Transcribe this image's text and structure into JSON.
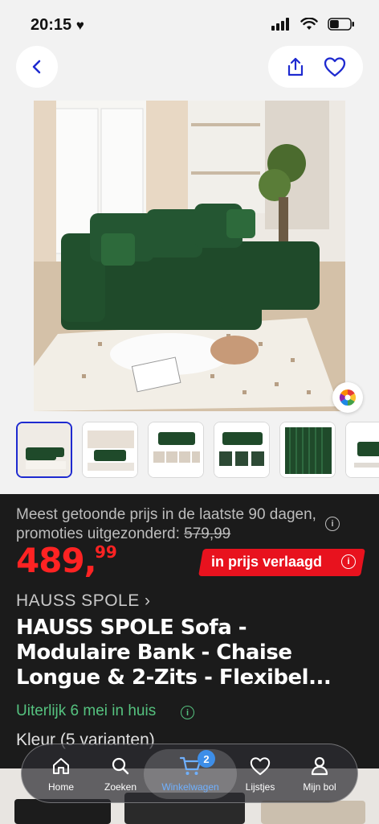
{
  "status_bar": {
    "time": "20:15",
    "battery_level": 0.45
  },
  "nav": {
    "back_icon": "chevron-left-icon",
    "share_icon": "share-icon",
    "favorite_icon": "heart-icon"
  },
  "gallery": {
    "selected_index": 0,
    "thumbnail_count": 6
  },
  "pricing": {
    "reference_text": "Meest getoonde prijs in de laatste 90 dagen, promoties uitgezonderd: ",
    "reference_price": "579,99",
    "price_whole": "489,",
    "price_fraction": "99",
    "badge": "in prijs verlaagd"
  },
  "product": {
    "brand": "HAUSS SPOLE ›",
    "title": "HAUSS SPOLE Sofa - Modulaire Bank - Chaise Longue & 2-Zits - Flexibel...",
    "delivery": "Uiterlijk 6 mei in huis",
    "variants": "Kleur (5 varianten)"
  },
  "tabbar": {
    "items": [
      {
        "label": "Home",
        "icon": "home-icon"
      },
      {
        "label": "Zoeken",
        "icon": "search-icon"
      },
      {
        "label": "Winkelwagen",
        "icon": "cart-icon",
        "badge": "2"
      },
      {
        "label": "Lijstjes",
        "icon": "heart-icon"
      },
      {
        "label": "Mijn bol",
        "icon": "user-icon"
      }
    ]
  },
  "colors": {
    "accent_blue": "#1e2ad0",
    "price_red": "#ff2323",
    "badge_red": "#e8121e",
    "delivery_green": "#55c27f",
    "sofa_green": "#1f4a2a"
  }
}
